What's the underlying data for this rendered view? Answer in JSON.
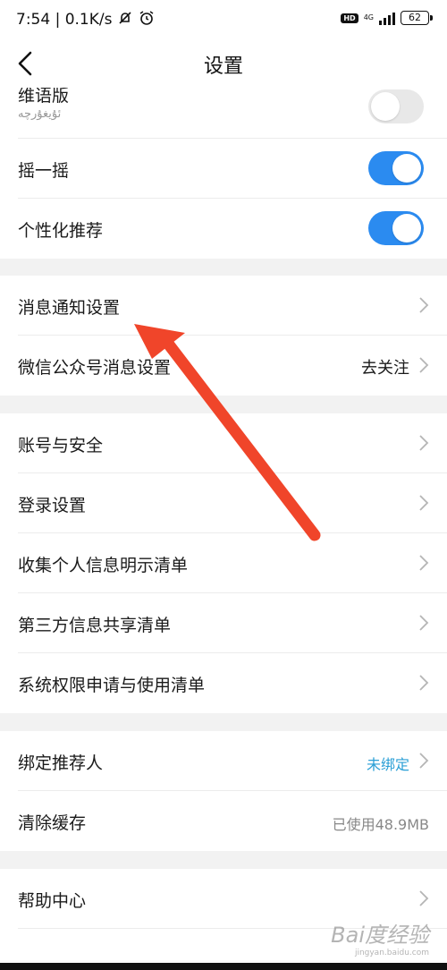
{
  "status_bar": {
    "time_speed": "7:54 | 0.1K/s",
    "network": "4G",
    "hd": "HD",
    "battery": "62"
  },
  "header": {
    "title": "设置"
  },
  "rows": {
    "uyghur": {
      "label": "维语版",
      "sub": "ئۇيغۇرچە",
      "toggle": "off"
    },
    "shake": {
      "label": "摇一摇",
      "toggle": "on"
    },
    "personalized": {
      "label": "个性化推荐",
      "toggle": "on"
    },
    "notifications": {
      "label": "消息通知设置"
    },
    "wechat": {
      "label": "微信公众号消息设置",
      "value": "去关注"
    },
    "account": {
      "label": "账号与安全"
    },
    "login": {
      "label": "登录设置"
    },
    "personal_info": {
      "label": "收集个人信息明示清单"
    },
    "third_party": {
      "label": "第三方信息共享清单"
    },
    "permissions": {
      "label": "系统权限申请与使用清单"
    },
    "referrer": {
      "label": "绑定推荐人",
      "value": "未绑定"
    },
    "cache": {
      "label": "清除缓存",
      "value": "已使用48.9MB"
    },
    "help": {
      "label": "帮助中心"
    }
  },
  "watermark": {
    "logo": "Bai度经验",
    "url": "jingyan.baidu.com"
  },
  "colors": {
    "accent": "#2b8bf0",
    "link": "#2a9fd6",
    "arrow": "#f0452a"
  }
}
